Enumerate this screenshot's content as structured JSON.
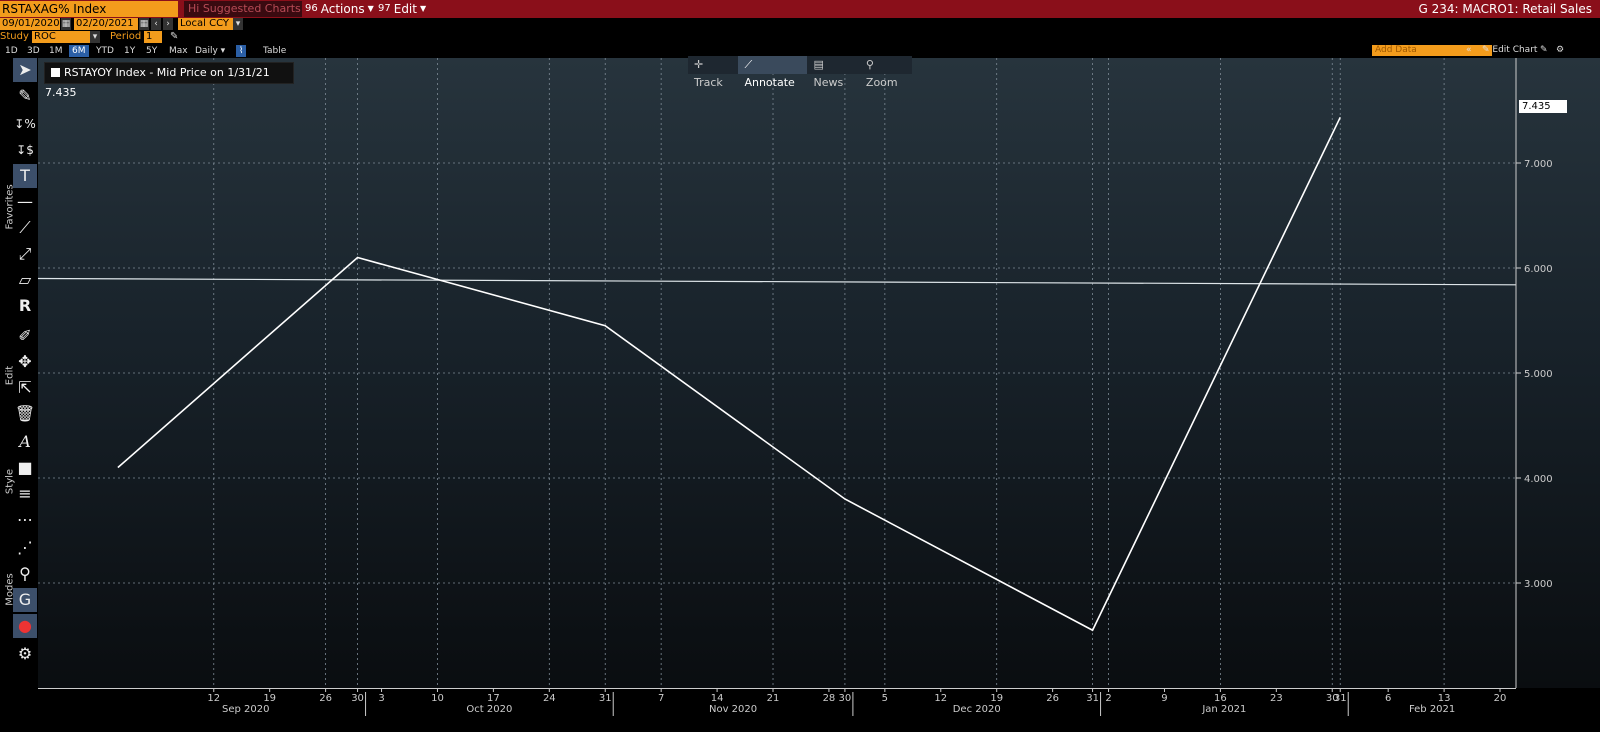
{
  "header": {
    "ticker": "RSTAXAG% Index",
    "suggested": "Hi Suggested Charts",
    "actions_num": "96",
    "actions_label": "Actions",
    "edit_num": "97",
    "edit_label": "Edit",
    "right_title": "G 234: MACRO1: Retail Sales"
  },
  "controls": {
    "start_date": "09/01/2020",
    "end_date": "02/20/2021",
    "currency": "Local CCY",
    "study_label": "Study",
    "study_value": "ROC",
    "period_label": "Period",
    "period_value": "1",
    "ranges": [
      "1D",
      "3D",
      "1M",
      "6M",
      "YTD",
      "1Y",
      "5Y",
      "Max"
    ],
    "active_range": "6M",
    "frequency": "Daily",
    "table_label": "Table",
    "add_data_placeholder": "Add Data",
    "edit_chart_label": "Edit Chart"
  },
  "sidebar": {
    "section_favorites": "Favorites",
    "section_edit": "Edit",
    "section_style": "Style",
    "section_modes": "Modes"
  },
  "legend": {
    "text": "RSTAYOY Index - Mid Price on 1/31/21 7.435"
  },
  "chart_tools": {
    "track": "Track",
    "annotate": "Annotate",
    "news": "News",
    "zoom": "Zoom"
  },
  "last_value_label": "7.435",
  "chart_data": {
    "type": "line",
    "x": [
      "2020-08-31",
      "2020-09-30",
      "2020-10-31",
      "2020-11-30",
      "2020-12-31",
      "2021-01-31"
    ],
    "series": [
      {
        "values": [
          4.1,
          6.1,
          5.45,
          3.8,
          2.55,
          7.435
        ]
      }
    ],
    "reference_line": {
      "start": 5.9,
      "end": 5.84
    },
    "ylim": [
      2.0,
      8.0
    ],
    "y_ticks": [
      "3.000",
      "4.000",
      "5.000",
      "6.000",
      "7.000"
    ],
    "x_ticks": [
      "12",
      "19",
      "26",
      "30",
      "3",
      "10",
      "17",
      "24",
      "31",
      "7",
      "14",
      "21",
      "28",
      "30",
      "5",
      "12",
      "19",
      "26",
      "31",
      "2",
      "9",
      "16",
      "23",
      "30",
      "31",
      "6",
      "13",
      "20"
    ],
    "month_labels": [
      "Sep 2020",
      "Oct 2020",
      "Nov 2020",
      "Dec 2020",
      "Jan 2021",
      "Feb 2021"
    ],
    "grid": true,
    "line_color": "#ffffff"
  }
}
